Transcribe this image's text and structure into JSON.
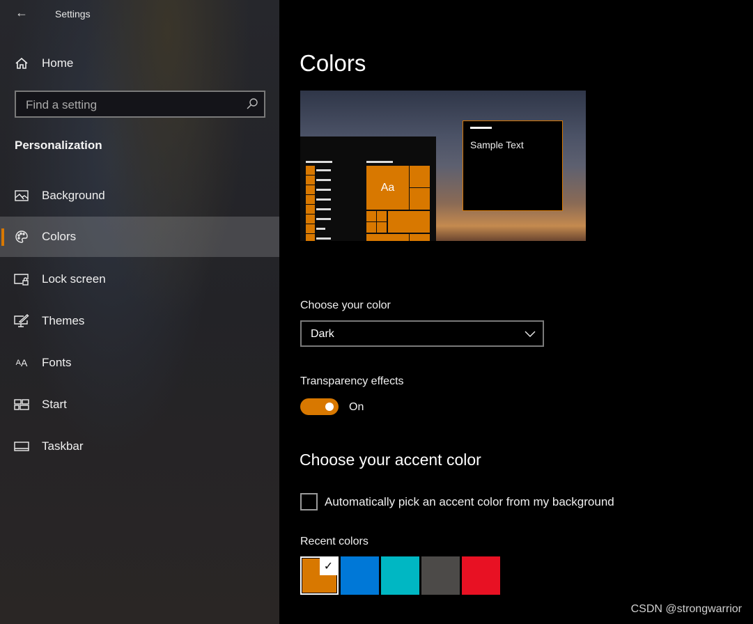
{
  "window": {
    "title": "Settings",
    "back_icon": "back-arrow-icon"
  },
  "sidebar": {
    "home": "Home",
    "search_placeholder": "Find a setting",
    "section": "Personalization",
    "items": [
      {
        "label": "Background",
        "icon": "picture-icon"
      },
      {
        "label": "Colors",
        "icon": "palette-icon",
        "selected": true
      },
      {
        "label": "Lock screen",
        "icon": "lock-screen-icon"
      },
      {
        "label": "Themes",
        "icon": "themes-icon"
      },
      {
        "label": "Fonts",
        "icon": "fonts-icon"
      },
      {
        "label": "Start",
        "icon": "start-icon"
      },
      {
        "label": "Taskbar",
        "icon": "taskbar-icon"
      }
    ]
  },
  "main": {
    "title": "Colors",
    "preview": {
      "tile_text": "Aa",
      "sample_text": "Sample Text"
    },
    "choose_color": {
      "label": "Choose your color",
      "value": "Dark"
    },
    "transparency": {
      "label": "Transparency effects",
      "state": "On",
      "on": true
    },
    "accent": {
      "heading": "Choose your accent color",
      "auto_pick_label": "Automatically pick an accent color from my background",
      "auto_pick_checked": false
    },
    "recent": {
      "label": "Recent colors",
      "colors": [
        "#d87800",
        "#0078d7",
        "#00b7c3",
        "#4c4a48",
        "#e81123"
      ],
      "selected": 0
    }
  },
  "accent_color": "#d87800",
  "watermark": "CSDN @strongwarrior"
}
